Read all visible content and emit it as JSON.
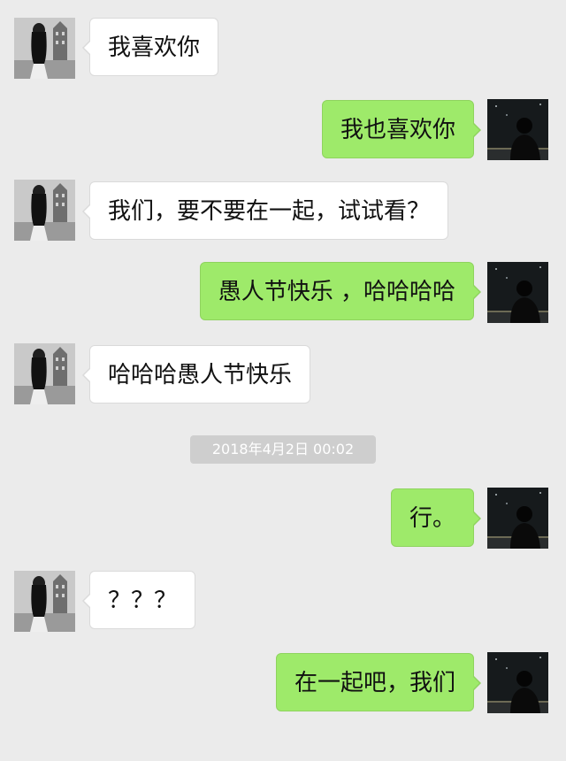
{
  "chat": {
    "messages": [
      {
        "sender": "her",
        "text": "我喜欢你"
      },
      {
        "sender": "me",
        "text": "我也喜欢你"
      },
      {
        "sender": "her",
        "text": "我们，要不要在一起，试试看？"
      },
      {
        "sender": "me",
        "text": "愚人节快乐 ，哈哈哈哈"
      },
      {
        "sender": "her",
        "text": "哈哈哈愚人节快乐"
      },
      {
        "sender": "me",
        "text": "行。"
      },
      {
        "sender": "her",
        "text": "？？？"
      },
      {
        "sender": "me",
        "text": "在一起吧，我们"
      }
    ],
    "timestamp": "2018年4月2日  00:02"
  },
  "colors": {
    "background": "#ebebeb",
    "incoming_bubble": "#ffffff",
    "outgoing_bubble": "#9eea6a",
    "timestamp_chip": "#cecece"
  },
  "icons": {
    "her_avatar": "girl-photo-avatar-icon",
    "me_avatar": "night-silhouette-avatar-icon"
  }
}
